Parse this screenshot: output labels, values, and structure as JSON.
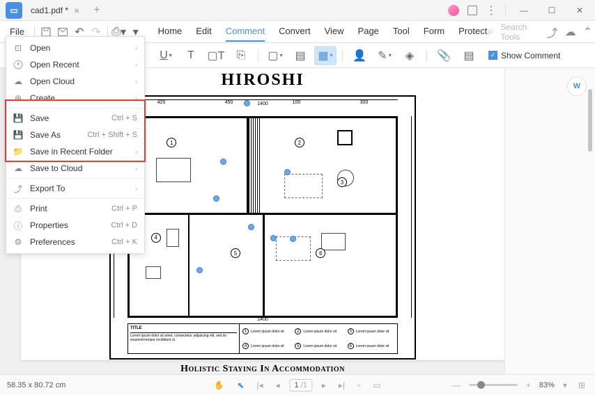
{
  "tab": {
    "title": "cad1.pdf *"
  },
  "menubar": {
    "file": "File",
    "tabs": [
      "Home",
      "Edit",
      "Comment",
      "Convert",
      "View",
      "Page",
      "Tool",
      "Form",
      "Protect"
    ],
    "active_tab": "Comment",
    "search_placeholder": "Search Tools"
  },
  "toolbar": {
    "show_comment": "Show Comment"
  },
  "file_menu": {
    "items": [
      {
        "label": "Open",
        "icon": "open",
        "arrow": true
      },
      {
        "label": "Open Recent",
        "icon": "recent",
        "arrow": true
      },
      {
        "label": "Open Cloud",
        "icon": "cloud",
        "arrow": true
      },
      {
        "label": "Create",
        "icon": "create",
        "arrow": true
      },
      {
        "label": "Save",
        "icon": "save",
        "shortcut": "Ctrl + S"
      },
      {
        "label": "Save As",
        "icon": "saveas",
        "shortcut": "Ctrl + Shift + S"
      },
      {
        "label": "Save in Recent Folder",
        "icon": "folder",
        "arrow": true
      },
      {
        "label": "Save to Cloud",
        "icon": "cloud2",
        "arrow": true
      },
      {
        "label": "Export To",
        "icon": "export",
        "arrow": true
      },
      {
        "label": "Print",
        "icon": "print",
        "shortcut": "Ctrl + P"
      },
      {
        "label": "Properties",
        "icon": "props",
        "shortcut": "Ctrl + D"
      },
      {
        "label": "Preferences",
        "icon": "prefs",
        "shortcut": "Ctrl + K"
      }
    ],
    "highlight_start": 4,
    "highlight_end": 7
  },
  "document": {
    "title": "HIROSHI",
    "subtitle": "Holistic Staying In Accommodation",
    "dim_top": "1400",
    "dim_segs_top": [
      "420",
      "450",
      "100",
      "300"
    ],
    "dim_bottom": "1400",
    "legend_title": "TITLE",
    "legend_text": "Lorem ipsum dolor sit amet, consectetur adipiscing elit, sed do eiusmod tempor incididunt ut",
    "legend_items": [
      "Lorem ipsum dolor sit",
      "Lorem ipsum dolor sit",
      "Lorem ipsum dolor sit",
      "Lorem ipsum dolor sit",
      "Lorem ipsum dolor sit",
      "Lorem ipsum dolor sit"
    ],
    "room_nums": [
      "1",
      "2",
      "3",
      "4",
      "5",
      "6"
    ]
  },
  "statusbar": {
    "coords": "58.35 x 80.72 cm",
    "page": "1",
    "total": "/1",
    "zoom": "83%"
  }
}
